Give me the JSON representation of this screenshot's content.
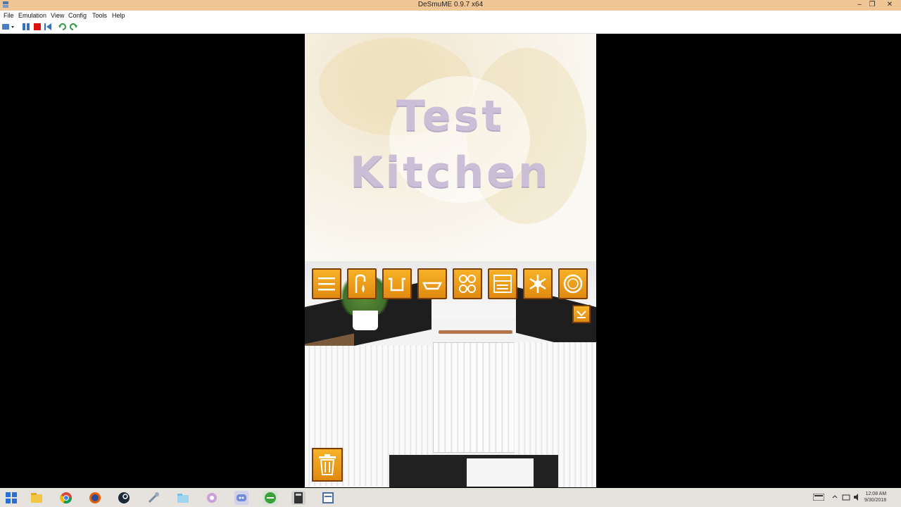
{
  "window": {
    "title": "DeSmuME 0.9.7 x64",
    "minimize": "–",
    "restore": "❐",
    "close": "✕"
  },
  "menu": {
    "items": [
      "File",
      "Emulation",
      "View",
      "Config",
      "Tools",
      "Help"
    ]
  },
  "game": {
    "title_line1": "Test",
    "title_line2": "Kitchen",
    "tools": [
      "menu-icon",
      "faucet-icon",
      "pot-icon",
      "pan-icon",
      "stovetop-icon",
      "oven-icon",
      "freezer-icon",
      "plate-icon"
    ],
    "small_button": "switch-view-icon",
    "trash": "trash-icon"
  },
  "taskbar": {
    "apps": [
      "windows-start-icon",
      "file-explorer-icon",
      "chrome-icon",
      "firefox-icon",
      "steam-icon",
      "tool-icon",
      "folder-icon",
      "app-icon",
      "discord-icon",
      "app-icon-2",
      "calculator-icon",
      "app-icon-3"
    ],
    "time": "12:08 AM",
    "date": "9/30/2018"
  },
  "colors": {
    "titlebar": "#f1c697",
    "button_orange": "#f6b227",
    "button_border": "#7a3d05"
  }
}
